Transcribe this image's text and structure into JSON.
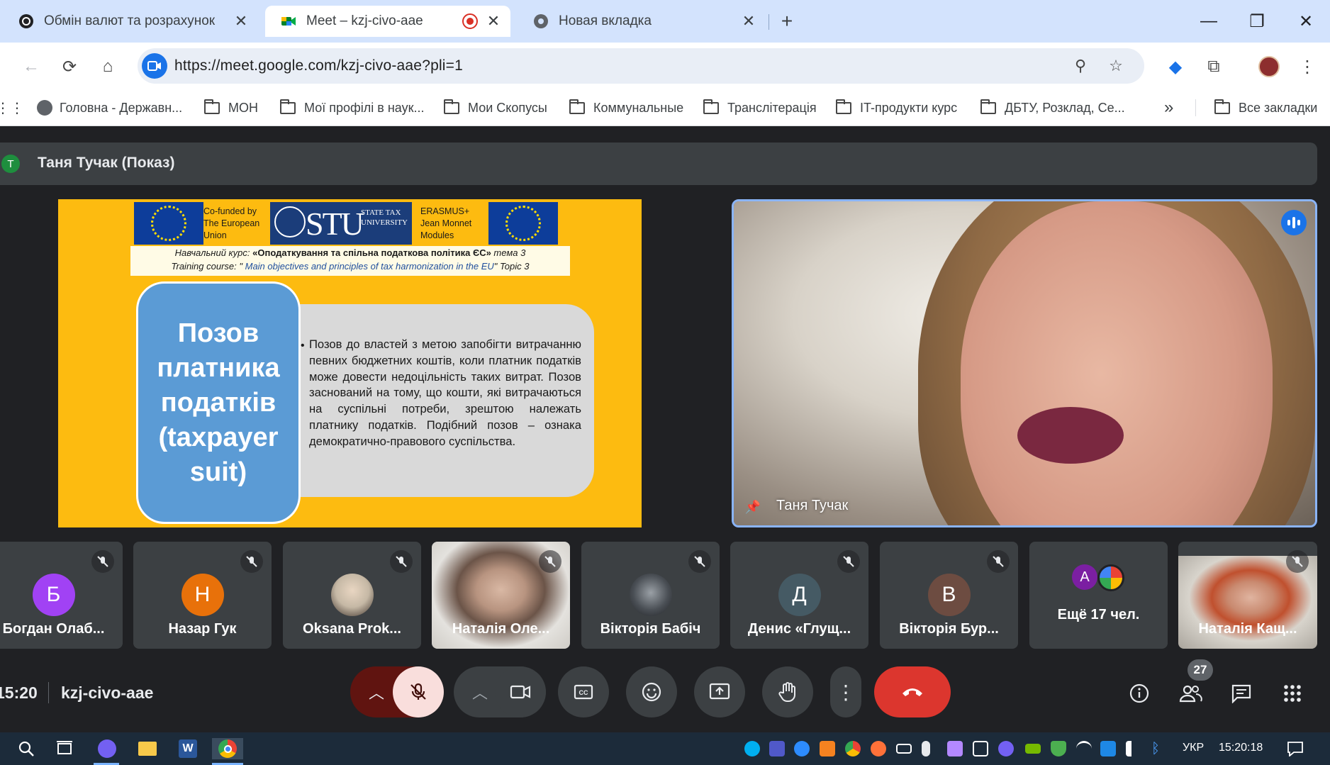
{
  "browser": {
    "tabs": [
      {
        "title": "Обмін валют та розрахунок",
        "active": false
      },
      {
        "title": "Meet – kzj-civo-aae",
        "active": true
      },
      {
        "title": "Новая вкладка",
        "active": false
      }
    ],
    "url": "https://meet.google.com/kzj-civo-aae?pli=1",
    "bookmarks": [
      {
        "label": "Головна - Державн...",
        "icon": "globe-icon"
      },
      {
        "label": "МОН",
        "icon": "folder-icon"
      },
      {
        "label": "Мої профілі в наук...",
        "icon": "folder-icon"
      },
      {
        "label": "Мои Скопусы",
        "icon": "folder-icon"
      },
      {
        "label": "Коммунальные",
        "icon": "folder-icon"
      },
      {
        "label": "Транслітерація",
        "icon": "folder-icon"
      },
      {
        "label": "IT-продукти курс",
        "icon": "folder-icon"
      },
      {
        "label": "ДБТУ, Розклад, Се...",
        "icon": "folder-icon"
      }
    ],
    "more_bookmarks": "»",
    "all_bookmarks": "Все закладки"
  },
  "meet": {
    "presenter_initial": "Т",
    "presenter_title": "Таня Тучак (Показ)",
    "slide": {
      "cofunded": "Co-funded by The European Union",
      "stu_big": "STU",
      "stu_small": "STATE TAX UNIVERSITY",
      "erasmus": "ERASMUS+ Jean Monnet Modules",
      "course_ua_prefix": "Навчальний курс: ",
      "course_ua_title": "«Оподаткування та спільна податкова політика ЄС»",
      "course_ua_topic": " тема 3",
      "course_en_prefix": "Training course: \" ",
      "course_en_title": "Main objectives and principles of tax harmonization in the EU",
      "course_en_topic": "\" Topic 3",
      "title": "Позов платника податків (taxpayer suit)",
      "bullet": "•",
      "body": "Позов до властей з метою запобігти витрачанню певних бюджетних коштів, коли платник податків може довести недоцільність таких витрат. Позов заснований на тому, що кошти, які витрачаються на суспільні потреби, зрештою належать платнику податків. Подібний позов – ознака демократично-правового суспільства."
    },
    "speaker_name": "Таня Тучак",
    "participants": [
      {
        "name": "Богдан Олаб...",
        "initial": "Б",
        "color": "#a142f4"
      },
      {
        "name": "Назар Гук",
        "initial": "Н",
        "color": "#e8710a"
      },
      {
        "name": "Oksana Prok...",
        "initial": "",
        "color": "#c5b8a5"
      },
      {
        "name": "Наталія Оле...",
        "initial": "",
        "color": ""
      },
      {
        "name": "Вікторія Бабіч",
        "initial": "",
        "color": "#5f6368"
      },
      {
        "name": "Денис «Глущ...",
        "initial": "Д",
        "color": "#455a64"
      },
      {
        "name": "Вікторія Бур...",
        "initial": "В",
        "color": "#6d4c41"
      },
      {
        "name": "Ещё 17 чел.",
        "initial": "А",
        "color": "#7b1fa2"
      },
      {
        "name": "Наталія Кащ...",
        "initial": "",
        "color": ""
      }
    ]
  },
  "bottom": {
    "time": "15:20",
    "code": "kzj-civo-aae",
    "participants_count": "27"
  },
  "taskbar": {
    "lang": "УКР",
    "time": "15:20:18"
  }
}
